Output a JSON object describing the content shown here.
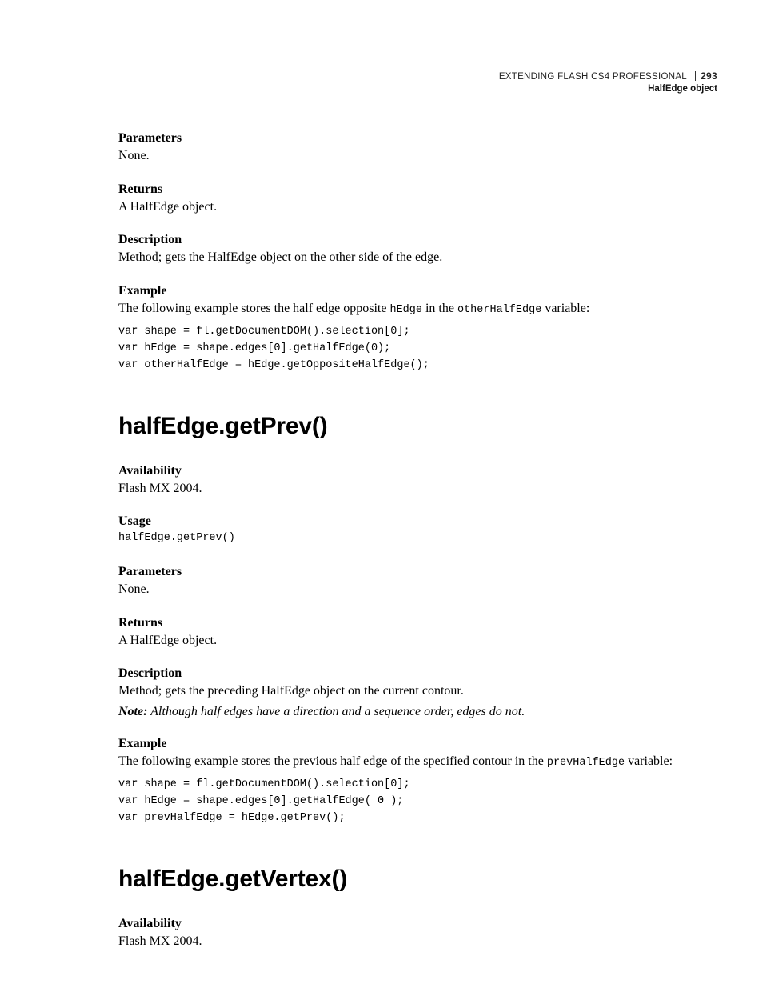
{
  "header": {
    "doc_title": "EXTENDING FLASH CS4 PROFESSIONAL",
    "page_number": "293",
    "section_title": "HalfEdge object"
  },
  "sections_top": [
    {
      "label": "Parameters",
      "body_plain": "None."
    },
    {
      "label": "Returns",
      "body_plain": "A HalfEdge object."
    },
    {
      "label": "Description",
      "body_plain": "Method; gets the HalfEdge object on the other side of the edge."
    }
  ],
  "example_top": {
    "label": "Example",
    "intro_pre": "The following example stores the half edge opposite ",
    "intro_code1": "hEdge",
    "intro_mid": " in the ",
    "intro_code2": "otherHalfEdge",
    "intro_post": " variable:",
    "code": "var shape = fl.getDocumentDOM().selection[0];\nvar hEdge = shape.edges[0].getHalfEdge(0);\nvar otherHalfEdge = hEdge.getOppositeHalfEdge();"
  },
  "api_getPrev": {
    "heading": "halfEdge.getPrev()",
    "availability_label": "Availability",
    "availability_body": "Flash MX 2004.",
    "usage_label": "Usage",
    "usage_code": "halfEdge.getPrev()",
    "parameters_label": "Parameters",
    "parameters_body": "None.",
    "returns_label": "Returns",
    "returns_body": "A HalfEdge object.",
    "description_label": "Description",
    "description_body": "Method; gets the preceding HalfEdge object on the current contour.",
    "note_label": "Note:",
    "note_body": " Although half edges have a direction and a sequence order, edges do not.",
    "example_label": "Example",
    "example_intro_pre": "The following example stores the previous half edge of the specified contour in the ",
    "example_intro_code": "prevHalfEdge",
    "example_intro_post": " variable:",
    "example_code": "var shape = fl.getDocumentDOM().selection[0];\nvar hEdge = shape.edges[0].getHalfEdge( 0 );\nvar prevHalfEdge = hEdge.getPrev();"
  },
  "api_getVertex": {
    "heading": "halfEdge.getVertex()",
    "availability_label": "Availability",
    "availability_body": "Flash MX 2004."
  }
}
